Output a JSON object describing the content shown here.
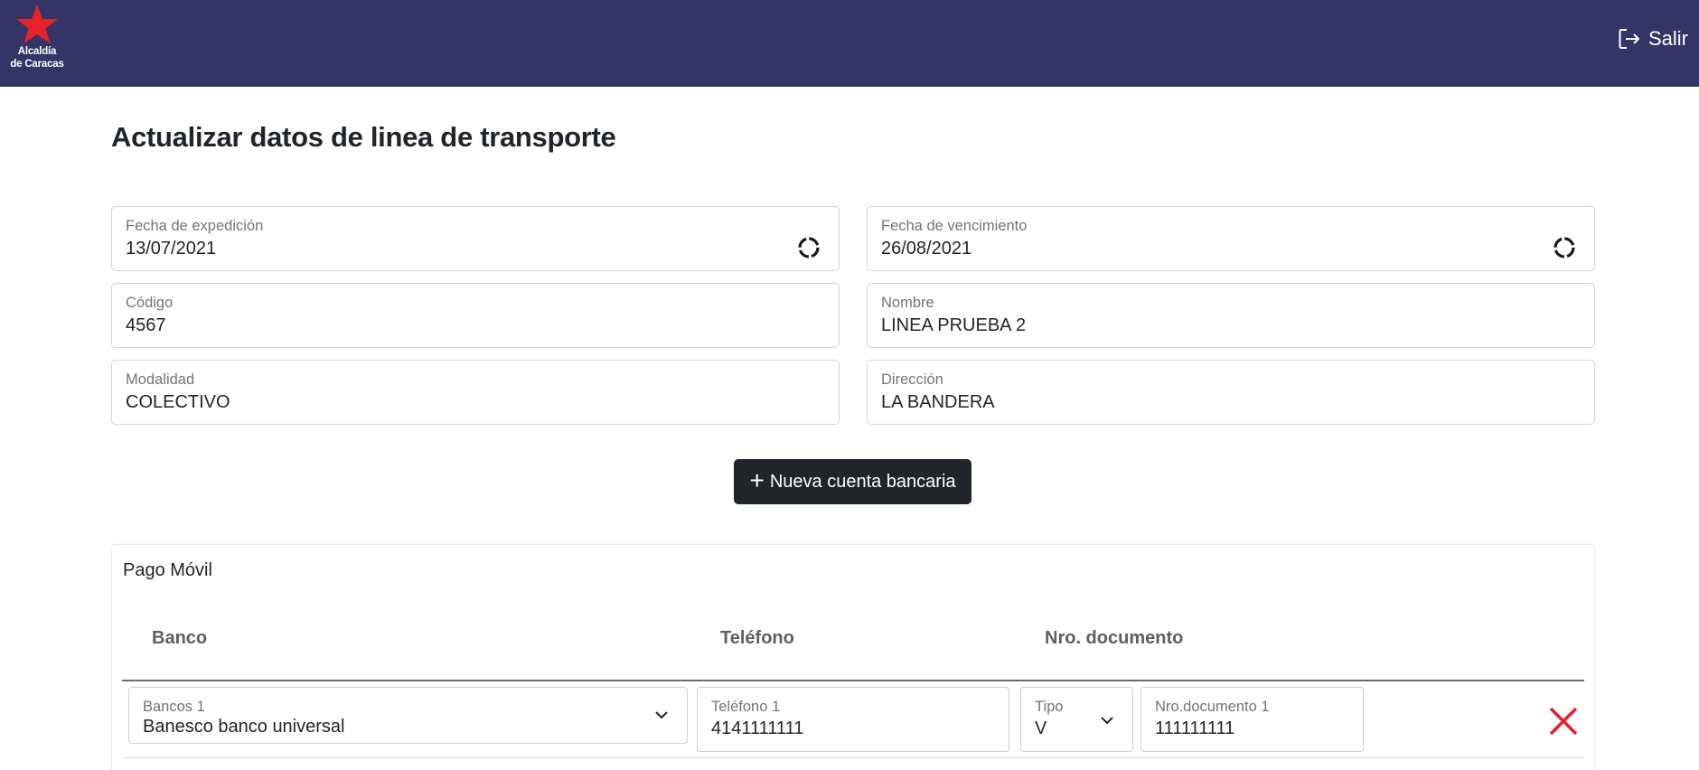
{
  "header": {
    "logo_line1": "Alcaldía",
    "logo_line2": "de Caracas",
    "logout_label": "Salir",
    "background": "#343566",
    "logo_star_color": "#e4232b"
  },
  "page": {
    "title": "Actualizar datos de linea de transporte"
  },
  "form": {
    "fecha_expedicion": {
      "label": "Fecha de expedición",
      "value": "13/07/2021"
    },
    "fecha_vencimiento": {
      "label": "Fecha de vencimiento",
      "value": "26/08/2021"
    },
    "codigo": {
      "label": "Código",
      "value": "4567"
    },
    "nombre": {
      "label": "Nombre",
      "value": "LINEA PRUEBA 2"
    },
    "modalidad": {
      "label": "Modalidad",
      "value": "COLECTIVO"
    },
    "direccion": {
      "label": "Dirección",
      "value": "LA BANDERA"
    }
  },
  "actions": {
    "new_account_plus": "+",
    "new_account_label": "Nueva cuenta bancaria"
  },
  "pago_movil": {
    "title": "Pago Móvil",
    "columns": [
      "Banco",
      "Teléfono",
      "Nro. documento"
    ],
    "rows": [
      {
        "banco_label": "Bancos 1",
        "banco_value": "Banesco banco universal",
        "telefono_label": "Teléfono 1",
        "telefono_value": "4141111111",
        "tipo_label": "Tipo",
        "tipo_value": "V",
        "documento_label": "Nro.documento 1",
        "documento_value": "111111111",
        "delete_icon": "close-x-icon",
        "delete_color": "#e4232b"
      }
    ]
  }
}
